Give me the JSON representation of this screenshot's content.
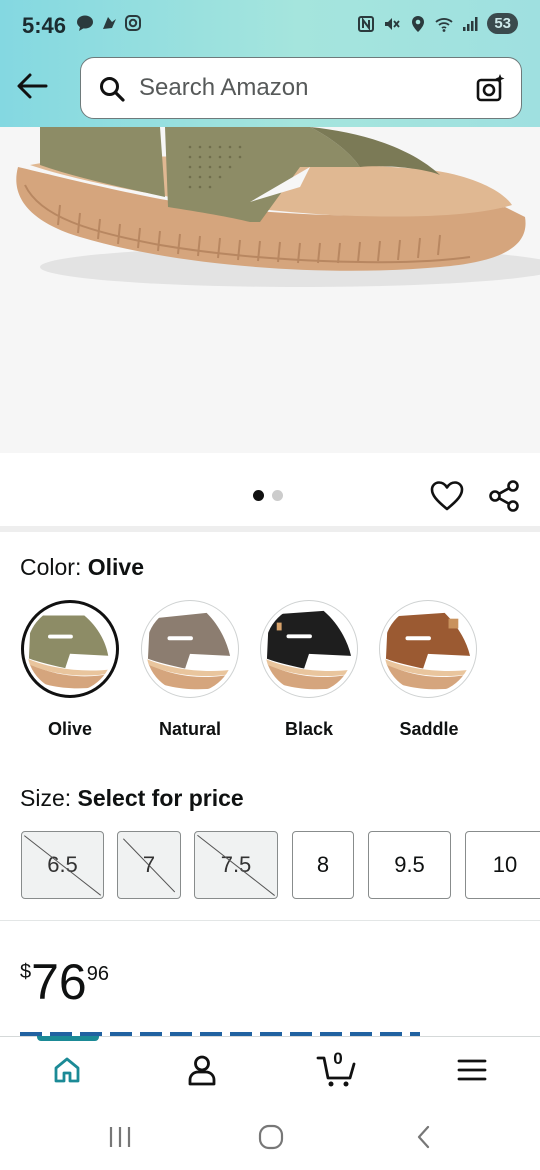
{
  "status_bar": {
    "time": "5:46",
    "battery": "53"
  },
  "header": {
    "search_placeholder": "Search Amazon"
  },
  "gallery": {
    "dot_count": 2,
    "active_index": 0
  },
  "color": {
    "label": "Color: ",
    "selected": "Olive",
    "options": [
      {
        "name": "Olive",
        "hex": "#8d8c66"
      },
      {
        "name": "Natural",
        "hex": "#8c7d70"
      },
      {
        "name": "Black",
        "hex": "#1e1e1e"
      },
      {
        "name": "Saddle",
        "hex": "#9b5a32"
      }
    ]
  },
  "size": {
    "label": "Size: ",
    "selected": "Select for price",
    "options": [
      {
        "label": "6.5",
        "available": false
      },
      {
        "label": "7",
        "available": false
      },
      {
        "label": "7.5",
        "available": false
      },
      {
        "label": "8",
        "available": true
      },
      {
        "label": "9.5",
        "available": true
      },
      {
        "label": "10",
        "available": true
      }
    ]
  },
  "price": {
    "symbol": "$",
    "whole": "76",
    "fraction": "96"
  },
  "bottom_nav": {
    "cart_count": "0",
    "active": "home"
  },
  "colors": {
    "accent": "#1b8a96",
    "header_gradient_start": "#84d8e1",
    "header_gradient_end": "#9fe0e0",
    "link": "#2162a1"
  }
}
